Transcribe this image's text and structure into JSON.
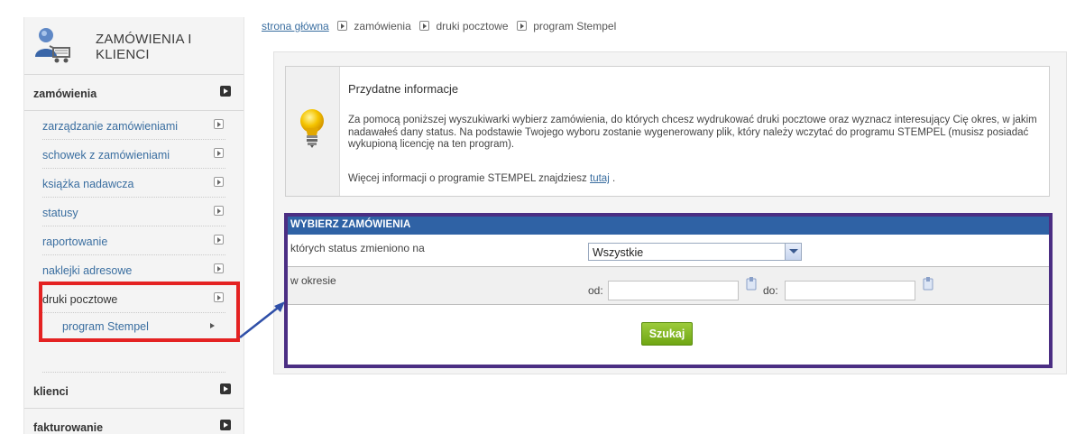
{
  "sidebar": {
    "header_title_line1": "ZAMÓWIENIA I",
    "header_title_line2": "KLIENCI",
    "sections": [
      {
        "label": "zamówienia"
      },
      {
        "label": "klienci"
      },
      {
        "label": "fakturowanie"
      }
    ],
    "items": [
      "zarządzanie zamówieniami",
      "schowek z zamówieniami",
      "książka nadawcza",
      "statusy",
      "raportowanie",
      "naklejki adresowe",
      "druki pocztowe"
    ],
    "sub_item": "program Stempel"
  },
  "breadcrumb": {
    "home": "strona główna",
    "crumbs": [
      "zamówienia",
      "druki pocztowe",
      "program Stempel"
    ]
  },
  "info": {
    "title": "Przydatne informacje",
    "text": "Za pomocą poniższej wyszukiwarki wybierz zamówienia, do których chcesz wydrukować druki pocztowe oraz wyznacz interesujący Cię okres, w jakim nadawałeś dany status. Na podstawie Twojego wyboru zostanie wygenerowany plik, który należy wczytać do programu STEMPEL (musisz posiadać wykupioną licencję na ten program).",
    "more_prefix": "Więcej informacji o programie STEMPEL znajdziesz",
    "more_link": "tutaj",
    "more_suffix": "."
  },
  "form": {
    "header": "WYBIERZ ZAMÓWIENIA",
    "status_label": "których status zmieniono na",
    "status_value": "Wszystkie",
    "period_label": "w okresie",
    "from_label": "od:",
    "to_label": "do:",
    "from_value": "",
    "to_value": "",
    "search_label": "Szukaj"
  },
  "colors": {
    "accent_blue": "#2f62a5",
    "highlight_red": "#e42222",
    "highlight_purple": "#4b2e83",
    "button_green": "#7fb524",
    "link": "#3a6ea0"
  }
}
